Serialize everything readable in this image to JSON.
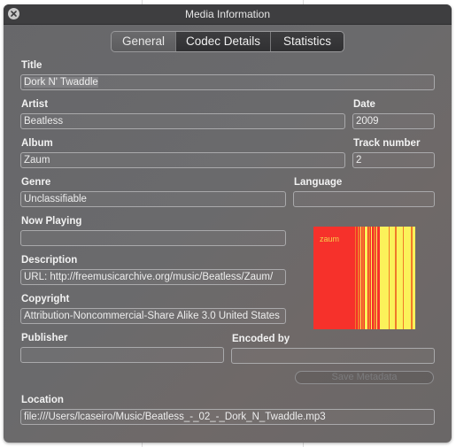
{
  "window": {
    "title": "Media Information",
    "close_icon": "close-icon"
  },
  "tabs": [
    {
      "label": "General",
      "selected": true
    },
    {
      "label": "Codec Details",
      "selected": false
    },
    {
      "label": "Statistics",
      "selected": false
    }
  ],
  "fields": {
    "title": {
      "label": "Title",
      "value": "Dork N' Twaddle"
    },
    "artist": {
      "label": "Artist",
      "value": "Beatless"
    },
    "date": {
      "label": "Date",
      "value": "2009"
    },
    "album": {
      "label": "Album",
      "value": "Zaum"
    },
    "track_number": {
      "label": "Track number",
      "value": "2"
    },
    "genre": {
      "label": "Genre",
      "value": "Unclassifiable"
    },
    "language": {
      "label": "Language",
      "value": ""
    },
    "now_playing": {
      "label": "Now Playing",
      "value": ""
    },
    "description": {
      "label": "Description",
      "value": "URL: http://freemusicarchive.org/music/Beatless/Zaum/"
    },
    "copyright": {
      "label": "Copyright",
      "value": "Attribution-Noncommercial-Share Alike 3.0 United States"
    },
    "publisher": {
      "label": "Publisher",
      "value": ""
    },
    "encoded_by": {
      "label": "Encoded by",
      "value": ""
    },
    "location": {
      "label": "Location",
      "value": "file:///Users/lcaseiro/Music/Beatless_-_02_-_Dork_N_Twaddle.mp3"
    }
  },
  "artwork": {
    "text": "zaum",
    "colors": {
      "red": "#f6312b",
      "orange": "#f07a2a",
      "yellow": "#fbf25a"
    }
  },
  "save_button": {
    "label": "Save Metadata",
    "enabled": false
  }
}
